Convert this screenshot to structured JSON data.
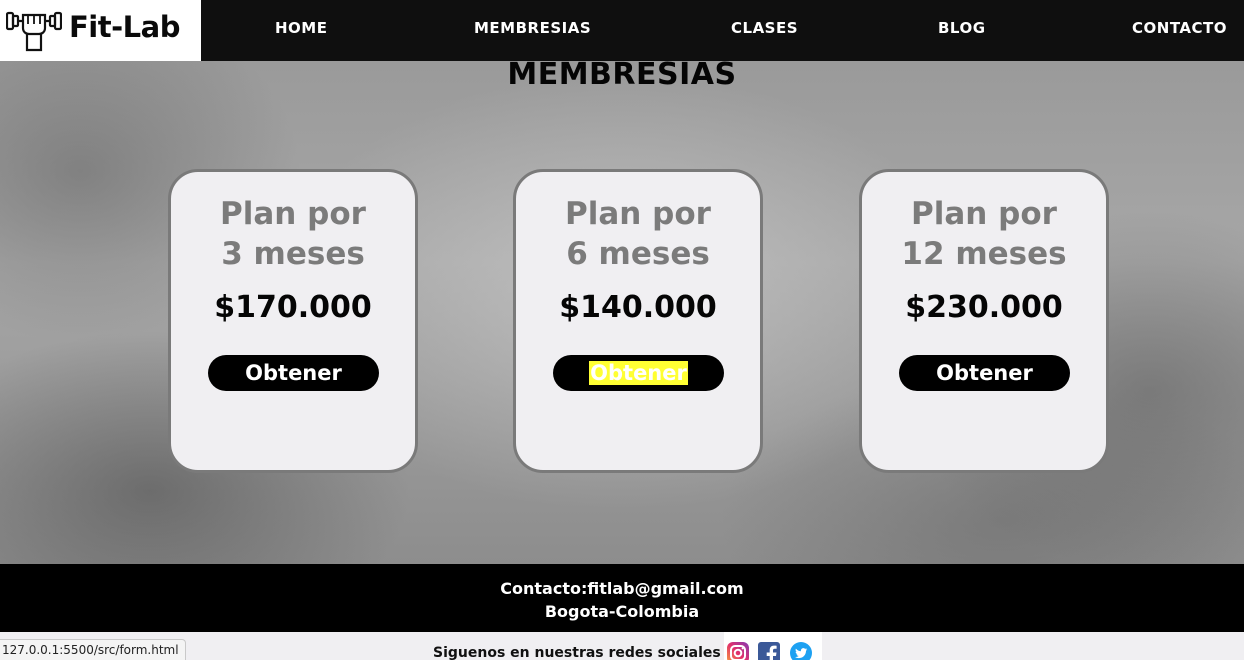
{
  "brand": {
    "name": "Fit-Lab",
    "logo_icon": "dumbbell-fist-icon"
  },
  "nav": {
    "items": [
      {
        "label": "HOME"
      },
      {
        "label": "MEMBRESIAS"
      },
      {
        "label": "CLASES"
      },
      {
        "label": "BLOG"
      },
      {
        "label": "CONTACTO"
      }
    ]
  },
  "main": {
    "title": "MEMBRESIAS",
    "plans": [
      {
        "name_line1": "Plan por",
        "name_line2": "3 meses",
        "price": "$170.000",
        "button": "Obtener"
      },
      {
        "name_line1": "Plan por",
        "name_line2": "6 meses",
        "price": "$140.000",
        "button": "Obtener",
        "button_selected": true
      },
      {
        "name_line1": "Plan por",
        "name_line2": "12 meses",
        "price": "$230.000",
        "button": "Obtener"
      }
    ]
  },
  "footer": {
    "contact": "Contacto:fitlab@gmail.com",
    "location": "Bogota-Colombia",
    "social_text": "Siguenos en nuestras redes sociales",
    "social_icons": [
      "instagram-icon",
      "facebook-icon",
      "twitter-icon"
    ]
  },
  "status_bar": {
    "url": "127.0.0.1:5500/src/form.html"
  },
  "colors": {
    "navbar": "#0f0f0f",
    "card": "#f0eff2",
    "card_border": "#7a7a7a",
    "plan_name": "#7b7b7b",
    "button": "#000000",
    "selection": "#ffff33"
  }
}
